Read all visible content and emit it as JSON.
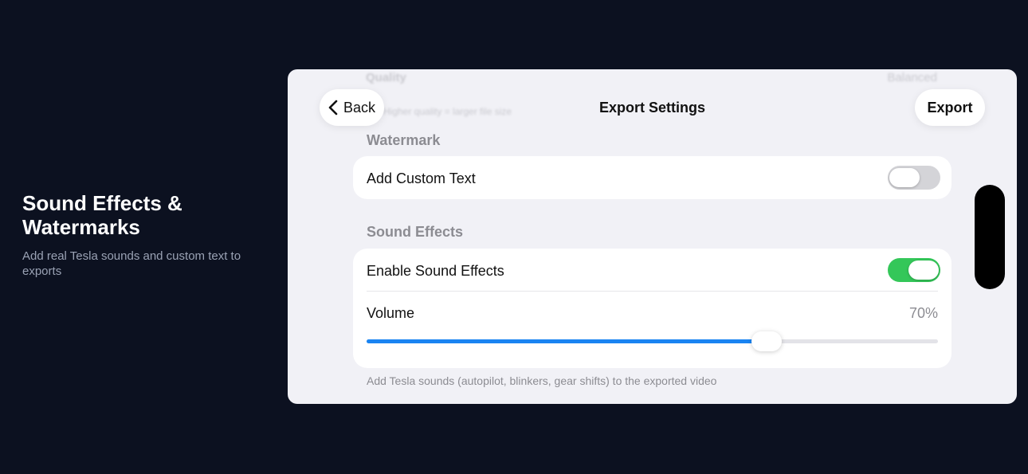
{
  "promo": {
    "title": "Sound Effects & Watermarks",
    "subtitle": "Add real Tesla sounds and custom text to exports"
  },
  "background_above": {
    "quality_label": "Quality",
    "quality_value": "Balanced",
    "quality_hint": "Higher quality = larger file size"
  },
  "nav": {
    "back_label": "Back",
    "title": "Export Settings",
    "export_label": "Export"
  },
  "watermark": {
    "section_label": "Watermark",
    "custom_text_label": "Add Custom Text",
    "custom_text_enabled": false
  },
  "sound_effects": {
    "section_label": "Sound Effects",
    "enable_label": "Enable Sound Effects",
    "enabled": true,
    "volume_label": "Volume",
    "volume_value": "70%",
    "volume_fraction": 0.7,
    "footnote": "Add Tesla sounds (autopilot, blinkers, gear shifts) to the exported video"
  },
  "colors": {
    "page_background": "#0c1120",
    "toggle_on": "#34c759",
    "toggle_off": "#d4d4d8",
    "slider_fill": "#1a84f2"
  },
  "icons": {
    "back": "chevron-left-icon"
  }
}
